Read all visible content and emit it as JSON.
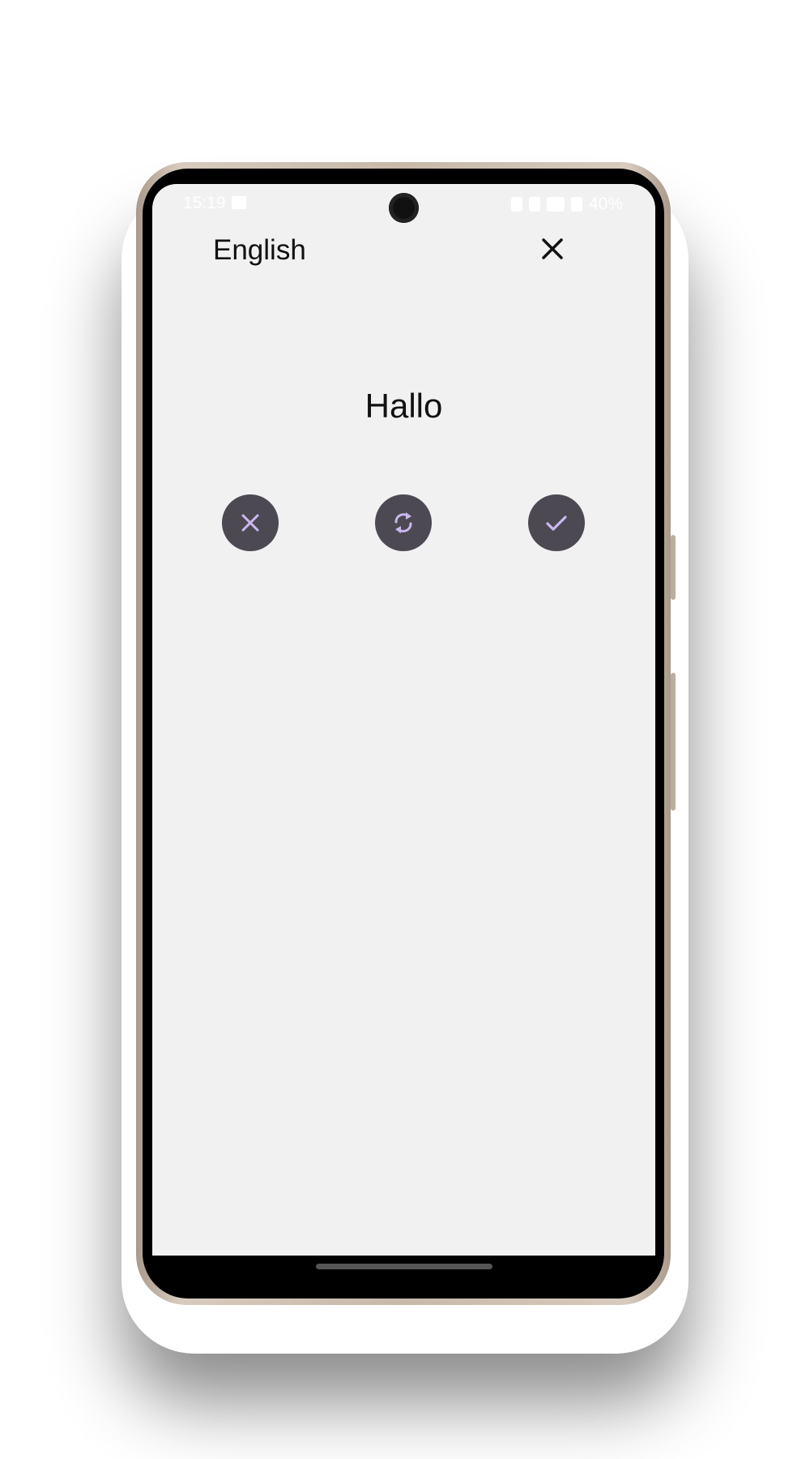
{
  "status_bar": {
    "time": "15:19",
    "battery": "40%"
  },
  "header": {
    "language": "English",
    "close_icon": "close-icon"
  },
  "card": {
    "word": "Hallo"
  },
  "actions": [
    {
      "name": "wrong-button",
      "icon": "x-icon"
    },
    {
      "name": "flip-button",
      "icon": "refresh-icon"
    },
    {
      "name": "correct-button",
      "icon": "check-icon"
    }
  ],
  "colors": {
    "screen_bg": "#f1f1f1",
    "button_bg": "#4d4953",
    "icon_accent": "#cbb8f0",
    "text": "#111111"
  }
}
